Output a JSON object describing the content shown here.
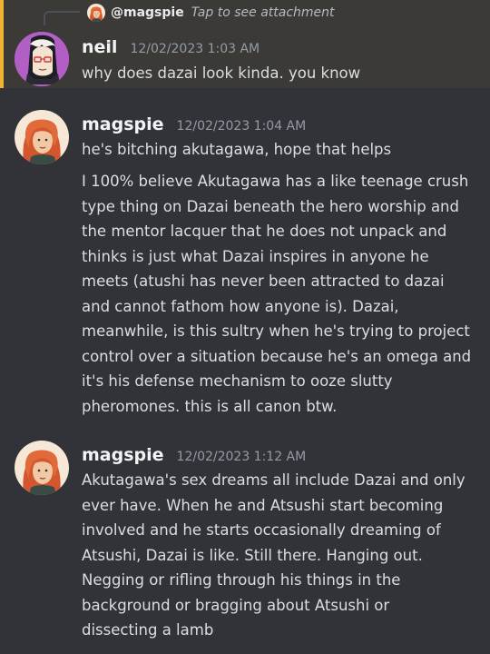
{
  "reply": {
    "author": "@magspie",
    "text": "Tap to see attachment"
  },
  "messages": [
    {
      "author": "neil",
      "timestamp": "12/02/2023 1:03 AM",
      "highlighted": true,
      "avatar_icon": "anime-character-avatar",
      "lines": [
        "why does dazai look kinda. you know"
      ]
    },
    {
      "author": "magspie",
      "timestamp": "12/02/2023 1:04 AM",
      "avatar_icon": "redhead-portrait-avatar",
      "lines": [
        "he's bitching akutagawa, hope that helps",
        "I 100% believe Akutagawa has a like teenage crush",
        "type thing on Dazai beneath the hero worship and",
        "the mentor lacquer that he does not unpack and",
        "thinks is just what Dazai inspires in anyone he",
        "meets (atushi has never been attracted to dazai",
        "and cannot fathom how anyone is). Dazai,",
        "meanwhile, is this sultry when he's trying to project",
        "control over a situation because he's an omega and",
        "it's his defense mechanism to ooze slutty",
        "pheromones. this is all canon btw."
      ]
    },
    {
      "author": "magspie",
      "timestamp": "12/02/2023 1:12 AM",
      "avatar_icon": "redhead-portrait-avatar",
      "lines": [
        "Akutagawa's sex dreams all include Dazai and only",
        "ever have. When he and Atsushi start becoming",
        "involved and he starts occasionally dreaming of",
        "Atsushi, Dazai is like. Still there. Hanging out.",
        "Negging or rifling through his things in the",
        "background or bragging about Atsushi or",
        "dissecting a lamb"
      ]
    }
  ],
  "colors": {
    "background": "#313338",
    "mention_bg": "#3b3a36",
    "mention_bar": "#f0b232"
  }
}
